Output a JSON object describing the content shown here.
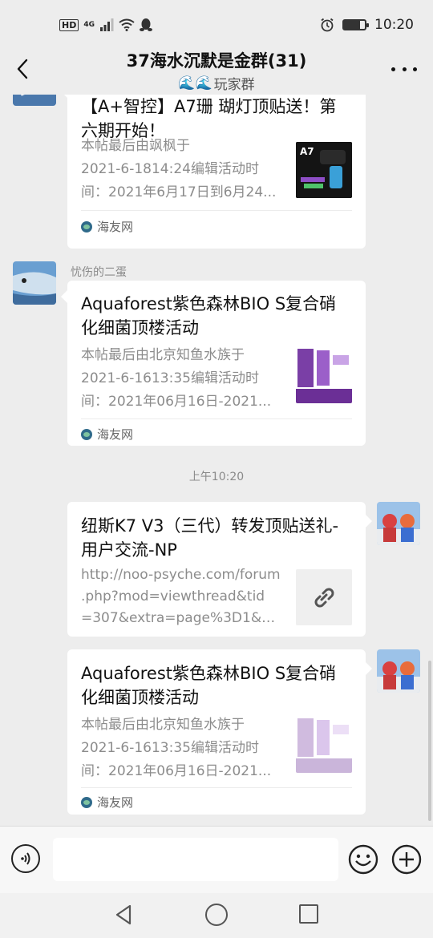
{
  "status_bar": {
    "left_indicators": [
      "HD",
      "4G"
    ],
    "time": "10:20",
    "battery_level": 0.75
  },
  "header": {
    "title": "37海水沉默是金群(31)",
    "subtitle_emoji": "🌊🌊",
    "subtitle_text": "玩家群"
  },
  "messages": [
    {
      "type": "card",
      "side": "left",
      "sender": "",
      "title": "【A+智控】A7珊 瑚灯顶贴送！第六期开始！",
      "desc_lines": [
        "本帖最后由飒枫于",
        "2021-6-1814:24编辑活动时",
        "间：2021年6月17日到6月24..."
      ],
      "thumb_label": "A7",
      "source": "海友网"
    },
    {
      "type": "card",
      "side": "left",
      "sender": "忧伤的二蛋",
      "title": "Aquaforest紫色森林BIO S复合硝化细菌顶楼活动",
      "desc_lines": [
        "本帖最后由北京知鱼水族于",
        "2021-6-1613:35编辑活动时",
        "间：2021年06月16日-2021..."
      ],
      "source": "海友网"
    },
    {
      "type": "time",
      "text": "上午10:20"
    },
    {
      "type": "link",
      "side": "right",
      "title": "纽斯K7 V3（三代）转发顶贴送礼- 用户交流-NP",
      "desc_lines": [
        "http://noo-psyche.com/forum",
        ".php?mod=viewthread&tid",
        "=307&extra=page%3D1&mo..."
      ]
    },
    {
      "type": "card",
      "side": "right",
      "title": "Aquaforest紫色森林BIO S复合硝化细菌顶楼活动",
      "desc_lines": [
        "本帖最后由北京知鱼水族于",
        "2021-6-1613:35编辑活动时",
        "间：2021年06月16日-2021..."
      ],
      "source": "海友网"
    }
  ],
  "colors": {
    "background": "#ededed",
    "card": "#ffffff",
    "secondary_text": "#8c8c8c"
  },
  "icons": {
    "back": "chevron-left-icon",
    "more": "more-icon",
    "voice": "voice-icon",
    "emoji": "emoji-icon",
    "plus": "plus-icon",
    "link": "link-icon"
  }
}
